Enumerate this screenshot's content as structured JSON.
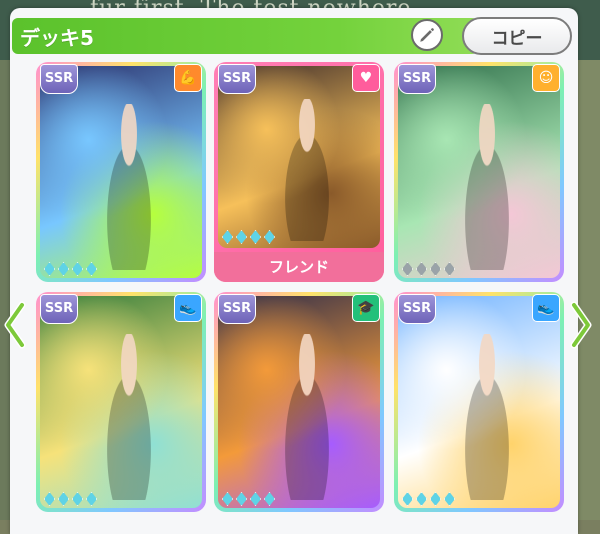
{
  "header": {
    "title": "デッキ5"
  },
  "buttons": {
    "copy_label": "コピー"
  },
  "background": {
    "board_text": "fur first. The test nowhere"
  },
  "cards": [
    {
      "rarity": "SSR",
      "type": "power-icon",
      "type_color": "#ff8a2c",
      "gems_active": 4,
      "friend": false,
      "palette": [
        "#2a2f6a",
        "#78c7ff",
        "#b6ff3d"
      ]
    },
    {
      "rarity": "SSR",
      "type": "heart-icon",
      "type_color": "#ff5d9c",
      "gems_active": 4,
      "friend": true,
      "friend_label": "フレンド",
      "palette": [
        "#3b2a2a",
        "#f6c05a",
        "#8a5a2a"
      ]
    },
    {
      "rarity": "SSR",
      "type": "smile-icon",
      "type_color": "#ffb02e",
      "gems_active": 0,
      "friend": false,
      "palette": [
        "#2f6e4a",
        "#a8e6b3",
        "#f4c7d6"
      ]
    },
    {
      "rarity": "SSR",
      "type": "shoe-icon",
      "type_color": "#3aa6ff",
      "gems_active": 4,
      "friend": false,
      "palette": [
        "#2e7a3a",
        "#f6e27a",
        "#8fe0d4"
      ]
    },
    {
      "rarity": "SSR",
      "type": "graduation-cap-icon",
      "type_color": "#23c07a",
      "gems_active": 4,
      "friend": false,
      "palette": [
        "#2b2b4a",
        "#f39a3a",
        "#a65cff"
      ]
    },
    {
      "rarity": "SSR",
      "type": "shoe-icon",
      "type_color": "#3aa6ff",
      "gems_active": 4,
      "friend": false,
      "palette": [
        "#6fb2ff",
        "#ffffff",
        "#ffd36b"
      ]
    }
  ],
  "bottom_strip_colors": [
    "#d73a3a",
    "#3a6fd7",
    "#e2c13a",
    "#4ab24a",
    "#d73a3a",
    "#e2c13a"
  ]
}
